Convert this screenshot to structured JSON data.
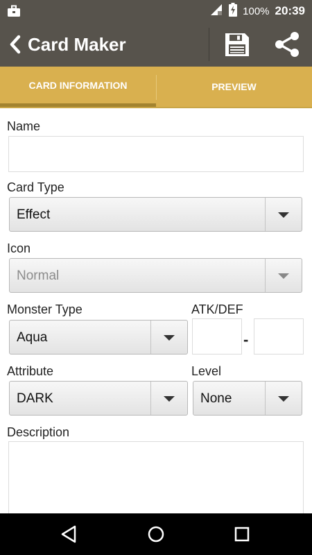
{
  "status_bar": {
    "battery": "100%",
    "time": "20:39",
    "icons": [
      "briefcase-icon",
      "signal-icon",
      "battery-icon"
    ]
  },
  "app_bar": {
    "title": "Card Maker",
    "icons": [
      "back-arrow-icon",
      "save-icon",
      "share-icon"
    ]
  },
  "tabs": [
    {
      "label": "CARD INFORMATION",
      "active": true
    },
    {
      "label": "PREVIEW",
      "active": false
    }
  ],
  "form": {
    "name_label": "Name",
    "name_value": "",
    "card_type_label": "Card Type",
    "card_type_value": "Effect",
    "icon_label": "Icon",
    "icon_value": "Normal",
    "monster_type_label": "Monster Type",
    "monster_type_value": "Aqua",
    "atkdef_label": "ATK/DEF",
    "atk_value": "",
    "atkdef_separator": "-",
    "def_value": "",
    "attribute_label": "Attribute",
    "attribute_value": "DARK",
    "level_label": "Level",
    "level_value": "None",
    "description_label": "Description",
    "description_value": ""
  },
  "colors": {
    "app_bar": "#57534c",
    "tab_bar": "#d9b04f",
    "tab_indicator": "#a3832f"
  },
  "nav_bar": {
    "icons": [
      "back-triangle-icon",
      "home-circle-icon",
      "recents-square-icon"
    ]
  }
}
